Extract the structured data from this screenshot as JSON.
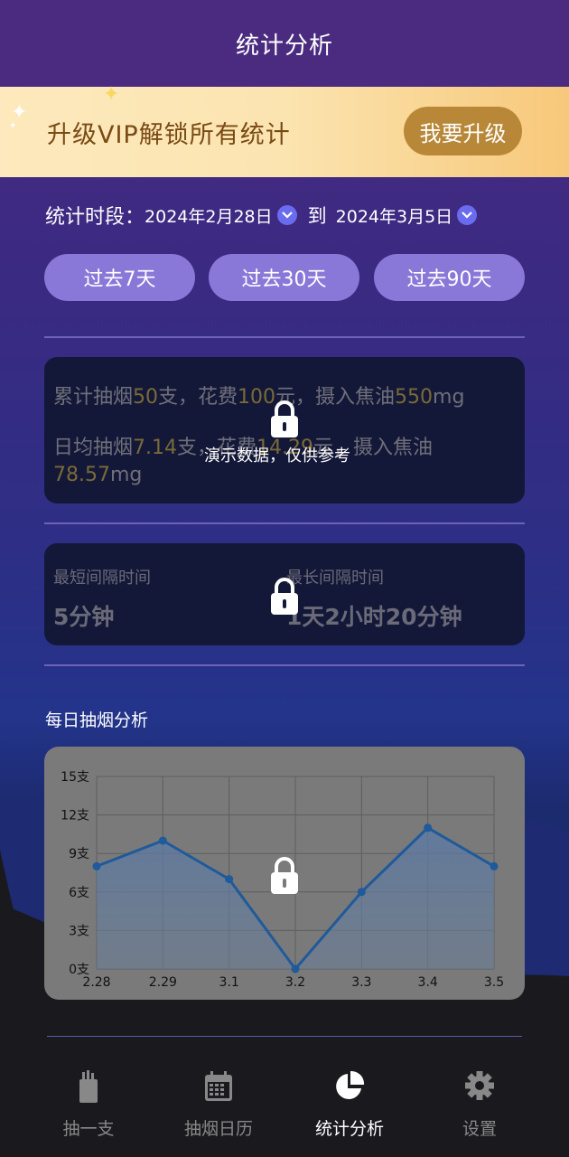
{
  "header": {
    "title": "统计分析"
  },
  "vip_banner": {
    "text": "升级VIP解锁所有统计",
    "button_label": "我要升级"
  },
  "period": {
    "label": "统计时段：",
    "start_date": "2024年2月28日",
    "to": "到",
    "end_date": "2024年3月5日"
  },
  "ranges": [
    "过去7天",
    "过去30天",
    "过去90天"
  ],
  "summary": {
    "line1": {
      "p1": "累计抽烟",
      "v1": "50",
      "p2": "支，花费",
      "v2": "100",
      "p3": "元，摄入焦油",
      "v3": "550",
      "p4": "mg"
    },
    "line2": {
      "p1": "日均抽烟",
      "v1": "7.14",
      "p2": "支，花费",
      "v2": "14.29",
      "p3": "元，摄入焦油",
      "v3": "78.57",
      "p4": "mg"
    },
    "demo_note": "演示数据，仅供参考"
  },
  "intervals": {
    "shortest_label": "最短间隔时间",
    "shortest_value": "5分钟",
    "longest_label": "最长间隔时间",
    "longest_value": "1天2小时20分钟"
  },
  "daily_section_title": "每日抽烟分析",
  "chart_data": {
    "type": "area",
    "categories": [
      "2.28",
      "2.29",
      "3.1",
      "3.2",
      "3.3",
      "3.4",
      "3.5"
    ],
    "values": [
      8,
      10,
      7,
      0,
      6,
      11,
      8
    ],
    "y_ticks": [
      "0支",
      "3支",
      "6支",
      "9支",
      "12支",
      "15支"
    ],
    "ylim": [
      0,
      15
    ],
    "grid": true,
    "line_color": "#1f5a9a"
  },
  "tabbar": {
    "items": [
      {
        "label": "抽一支",
        "icon": "cigarette-pack-icon",
        "active": false
      },
      {
        "label": "抽烟日历",
        "icon": "calendar-icon",
        "active": false
      },
      {
        "label": "统计分析",
        "icon": "pie-chart-icon",
        "active": true
      },
      {
        "label": "设置",
        "icon": "gear-icon",
        "active": false
      }
    ]
  },
  "colors": {
    "accent": "#8a78d8",
    "vip_button": "#b88838",
    "highlight": "#7a6a38"
  }
}
